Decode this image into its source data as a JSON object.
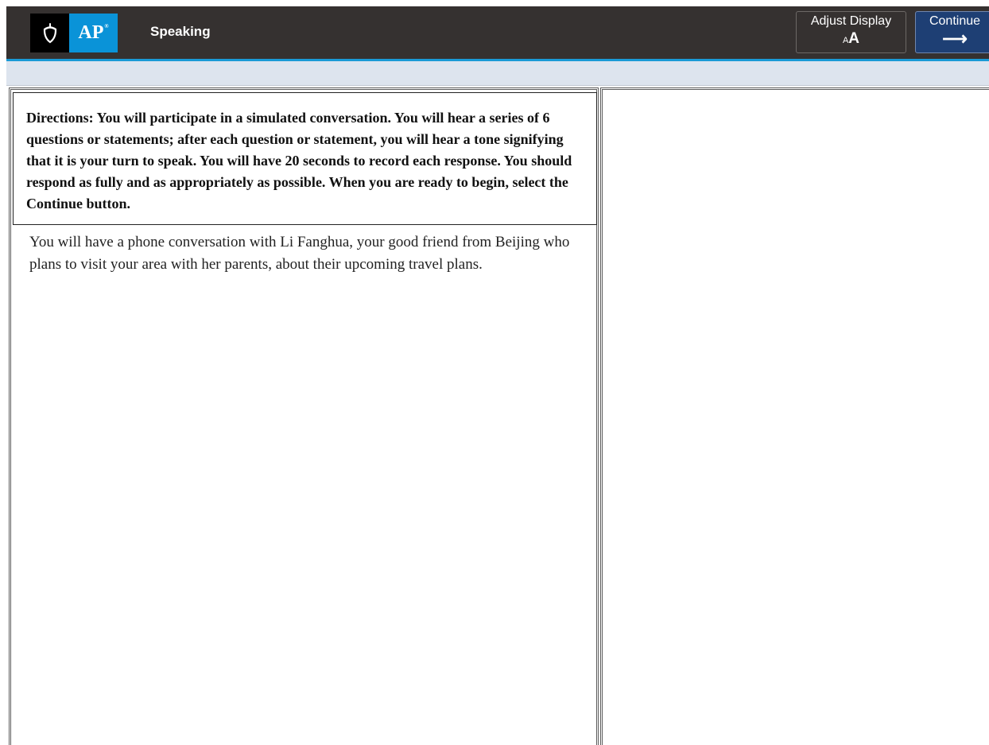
{
  "header": {
    "logo_text": "AP",
    "logo_mark": "®",
    "section_title": "Speaking"
  },
  "buttons": {
    "adjust_display_label": "Adjust Display",
    "adjust_display_icon_small": "A",
    "adjust_display_icon_big": "A",
    "continue_label": "Continue",
    "continue_icon": "⟶"
  },
  "icons": {
    "logo": "acorn-icon",
    "adjust": "text-size-icon",
    "continue": "arrow-right-icon"
  },
  "content": {
    "directions": "Directions: You will participate in a simulated conversation. You will hear a series of 6 questions or statements; after each question or statement, you will hear a tone signifying that it is your turn to speak. You will have 20 seconds to record each response. You should respond as fully and as appropriately as possible. When you are ready to begin, select the Continue button.",
    "prompt": "You will have a phone conversation with Li Fanghua, your good friend from Beijing who plans to visit your area with her parents, about their upcoming travel plans."
  },
  "colors": {
    "header_bg": "#353130",
    "header_accent": "#1a9ad6",
    "ap_blue": "#0a93d8",
    "continue_bg": "#1e3f74",
    "strip_bg": "#dde4ee"
  }
}
